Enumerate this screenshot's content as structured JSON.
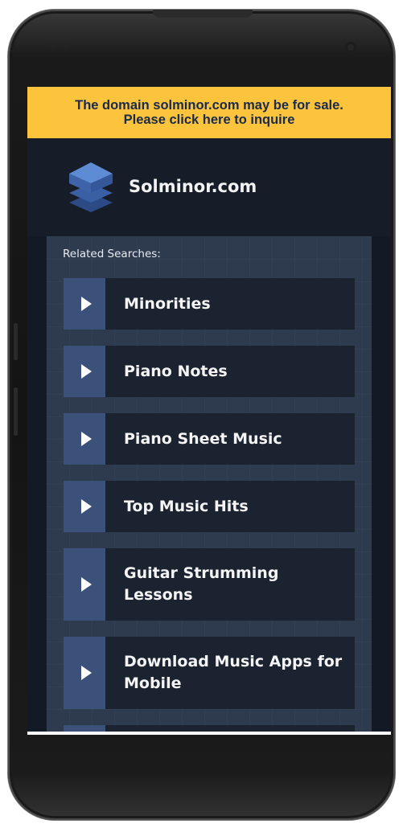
{
  "banner": {
    "line1": "The domain solminor.com may be for sale.",
    "line2": "Please click here to inquire"
  },
  "header": {
    "site_title": "Solminor.com",
    "logo_icon": "layers-stack-icon"
  },
  "related": {
    "label": "Related Searches:",
    "items": [
      {
        "label": "Minorities"
      },
      {
        "label": "Piano Notes"
      },
      {
        "label": "Piano Sheet Music"
      },
      {
        "label": "Top Music Hits"
      },
      {
        "label": "Guitar Strumming Lessons"
      },
      {
        "label": "Download Music Apps for Mobile"
      }
    ]
  },
  "colors": {
    "banner_bg": "#fcc33c",
    "banner_text": "#1a2a4a",
    "screen_bg": "#131a26",
    "panel_bg": "#2e3a4e",
    "arrow_cell_bg": "#3c5179",
    "item_bg": "#1b2330"
  }
}
